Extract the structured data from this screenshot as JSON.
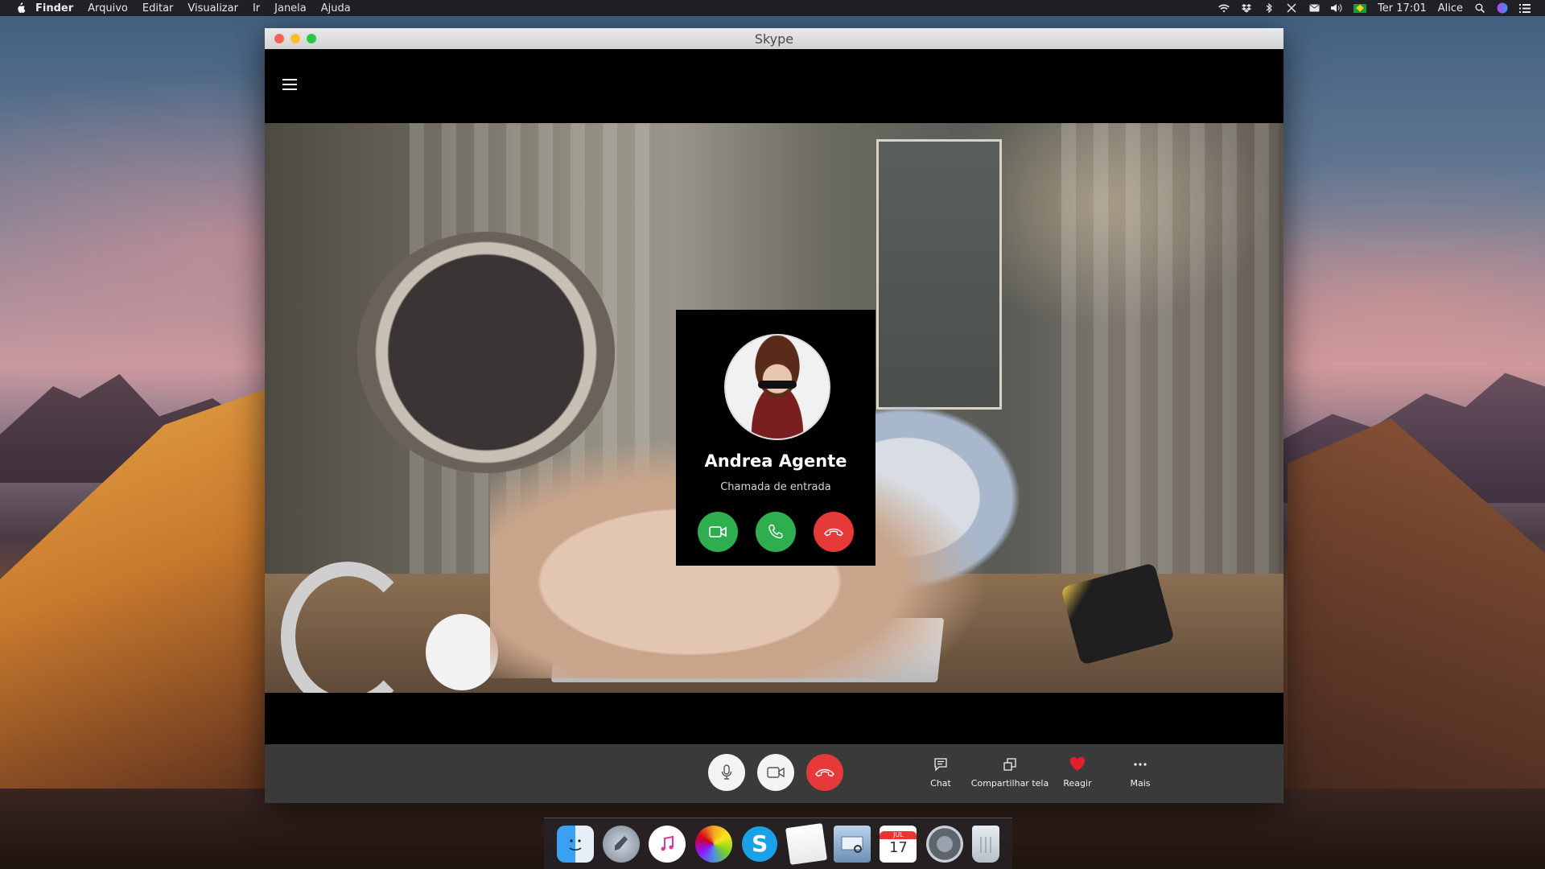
{
  "menubar": {
    "app": "Finder",
    "items": [
      "Arquivo",
      "Editar",
      "Visualizar",
      "Ir",
      "Janela",
      "Ajuda"
    ],
    "clock": "Ter 17:01",
    "user": "Alice"
  },
  "window": {
    "title": "Skype"
  },
  "incoming_call": {
    "caller_name": "Andrea Agente",
    "status": "Chamada de entrada"
  },
  "controls": {
    "chat_label": "Chat",
    "share_label": "Compartilhar tela",
    "react_label": "Reagir",
    "more_label": "Mais"
  },
  "dock": {
    "calendar_month": "JUL",
    "calendar_day": "17"
  },
  "colors": {
    "accept_green": "#2fae4f",
    "decline_red": "#e6393a",
    "skype_blue": "#1aa2e8"
  }
}
